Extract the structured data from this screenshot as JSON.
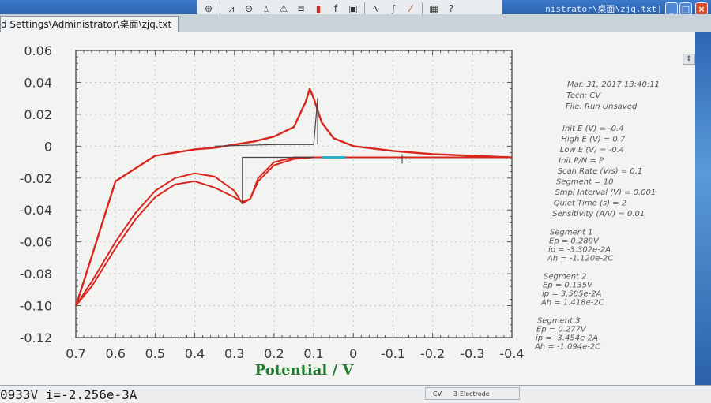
{
  "window": {
    "title": "nistrator\\桌面\\zjq.txt]",
    "document_tab": "d Settings\\Administrator\\桌面\\zjq.txt"
  },
  "toolbar": {
    "icons": [
      "save-icon",
      "undo-icon",
      "cut-icon",
      "copy-icon",
      "paste-icon",
      "clock-icon",
      "graph-icon",
      "zoom-icon",
      "peak-icon",
      "info-icon",
      "bars-icon",
      "color-bars-icon",
      "font-icon",
      "overlay-icon",
      "smooth-icon",
      "derivative-icon",
      "draw-icon",
      "table-icon",
      "help-icon"
    ]
  },
  "info_panel": {
    "header": [
      "Mar. 31, 2017   13:40:11",
      "Tech: CV",
      "File: Run Unsaved"
    ],
    "params": [
      "Init E (V) = -0.4",
      "High E (V) = 0.7",
      "Low E (V) = -0.4",
      "Init P/N = P",
      "Scan Rate (V/s) = 0.1",
      "Segment = 10",
      "Smpl Interval (V) = 0.001",
      "Quiet Time (s) = 2",
      "Sensitivity (A/V) = 0.01"
    ],
    "segments": [
      {
        "title": "Segment 1",
        "ep": "Ep = 0.289V",
        "ip": "ip = -3.302e-2A",
        "ah": "Ah = -1.120e-2C"
      },
      {
        "title": "Segment 2",
        "ep": "Ep = 0.135V",
        "ip": "ip = 3.585e-2A",
        "ah": "Ah = 1.418e-2C"
      },
      {
        "title": "Segment 3",
        "ep": "Ep = 0.277V",
        "ip": "ip = -3.454e-2A",
        "ah": "Ah = -1.094e-2C"
      }
    ]
  },
  "status": {
    "readout": "0933V   i=-2.256e-3A",
    "mode": "CV",
    "electrode": "3-Electrode"
  },
  "mdi_controls": "- ₽ ×",
  "colors": {
    "curve": "#d8261c",
    "baseline": "#444444",
    "axis_label": "#1f7a2c",
    "highlight": "#2ab0c6"
  },
  "chart_data": {
    "type": "line",
    "xlabel": "Potential / V",
    "ylabel": "",
    "x_axis_reversed": true,
    "xlim": [
      0.7,
      -0.4
    ],
    "ylim": [
      -0.12,
      0.06
    ],
    "x_ticks": [
      "0.7",
      "0.6",
      "0.5",
      "0.4",
      "0.3",
      "0.2",
      "0.1",
      "0",
      "-0.1",
      "-0.2",
      "-0.3",
      "-0.4"
    ],
    "y_ticks": [
      "0.06",
      "0.04",
      "0.02",
      "0",
      "-0.02",
      "-0.04",
      "-0.06",
      "-0.08",
      "-0.10",
      "-0.12"
    ],
    "grid": true,
    "series": [
      {
        "x": [
          -0.4,
          -0.3,
          -0.2,
          -0.1,
          0.0,
          0.05,
          0.08,
          0.1,
          0.11,
          0.12,
          0.15,
          0.2,
          0.25,
          0.3,
          0.35,
          0.4,
          0.5,
          0.6,
          0.68,
          0.7
        ],
        "y": [
          -0.007,
          -0.006,
          -0.005,
          -0.003,
          0.0,
          0.005,
          0.015,
          0.03,
          0.036,
          0.028,
          0.012,
          0.006,
          0.003,
          0.001,
          -0.001,
          -0.002,
          -0.006,
          -0.022,
          -0.085,
          -0.1
        ]
      },
      {
        "x": [
          0.7,
          0.66,
          0.6,
          0.55,
          0.5,
          0.45,
          0.4,
          0.35,
          0.3,
          0.28,
          0.26,
          0.24,
          0.2,
          0.15,
          0.1,
          0.05,
          0.0,
          -0.1,
          -0.2,
          -0.3,
          -0.4
        ],
        "y": [
          -0.1,
          -0.085,
          -0.06,
          -0.042,
          -0.028,
          -0.02,
          -0.017,
          -0.019,
          -0.028,
          -0.036,
          -0.033,
          -0.02,
          -0.01,
          -0.007,
          -0.007,
          -0.007,
          -0.007,
          -0.007,
          -0.007,
          -0.007,
          -0.007
        ]
      },
      {
        "x": [
          0.7,
          0.66,
          0.6,
          0.55,
          0.5,
          0.45,
          0.4,
          0.35,
          0.3,
          0.28,
          0.26,
          0.24,
          0.2,
          0.15,
          0.1
        ],
        "y": [
          -0.1,
          -0.088,
          -0.064,
          -0.046,
          -0.032,
          -0.024,
          -0.022,
          -0.026,
          -0.032,
          -0.035,
          -0.033,
          -0.022,
          -0.012,
          -0.008,
          -0.007
        ]
      },
      {
        "x": [
          0.28,
          0.28,
          0.28,
          0.27,
          0.25,
          0.2,
          0.1
        ],
        "y": [
          -0.036,
          -0.03,
          -0.007,
          -0.007,
          -0.007,
          -0.007,
          -0.007
        ]
      },
      {
        "x": [
          0.35,
          0.2,
          0.1,
          0.09,
          0.09
        ],
        "y": [
          0.0,
          0.001,
          0.001,
          0.03,
          0.001
        ]
      }
    ],
    "cursor": {
      "x": -0.123,
      "y": -0.008
    }
  }
}
